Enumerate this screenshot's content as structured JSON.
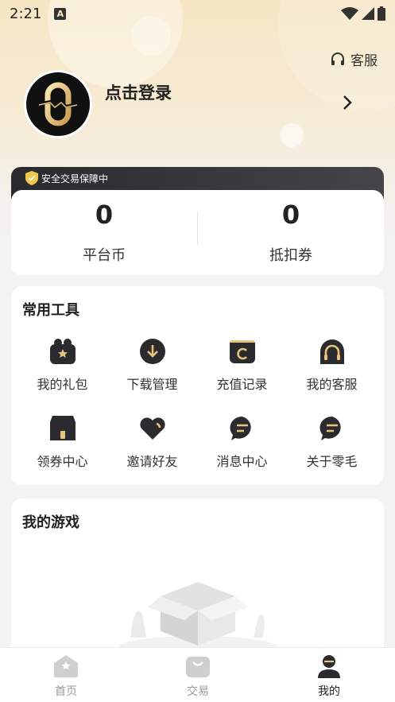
{
  "status_bar": {
    "time": "2:21",
    "notification_letter": "A",
    "icons": [
      "wifi-icon",
      "signal-icon",
      "battery-icon"
    ]
  },
  "header": {
    "service_label": "客服",
    "login_label": "点击登录"
  },
  "security": {
    "label": "安全交易保障中"
  },
  "balance": [
    {
      "value": "0",
      "label": "平台币"
    },
    {
      "value": "0",
      "label": "抵扣券"
    }
  ],
  "tools": {
    "title": "常用工具",
    "items": [
      {
        "label": "我的礼包",
        "icon": "gift-icon"
      },
      {
        "label": "下载管理",
        "icon": "download-icon"
      },
      {
        "label": "充值记录",
        "icon": "wallet-icon"
      },
      {
        "label": "我的客服",
        "icon": "headset-icon"
      },
      {
        "label": "领券中心",
        "icon": "store-icon"
      },
      {
        "label": "邀请好友",
        "icon": "heart-icon"
      },
      {
        "label": "消息中心",
        "icon": "message-icon"
      },
      {
        "label": "关于零毛",
        "icon": "info-chat-icon"
      }
    ]
  },
  "games": {
    "title": "我的游戏"
  },
  "tabbar": [
    {
      "label": "首页",
      "icon": "home-icon",
      "active": false
    },
    {
      "label": "交易",
      "icon": "bag-icon",
      "active": false
    },
    {
      "label": "我的",
      "icon": "user-icon",
      "active": true
    }
  ],
  "colors": {
    "accent_gold": "#e8c27a",
    "dark_icon": "#2b2b2f",
    "inactive": "#bdbdbd",
    "active": "#222222"
  }
}
